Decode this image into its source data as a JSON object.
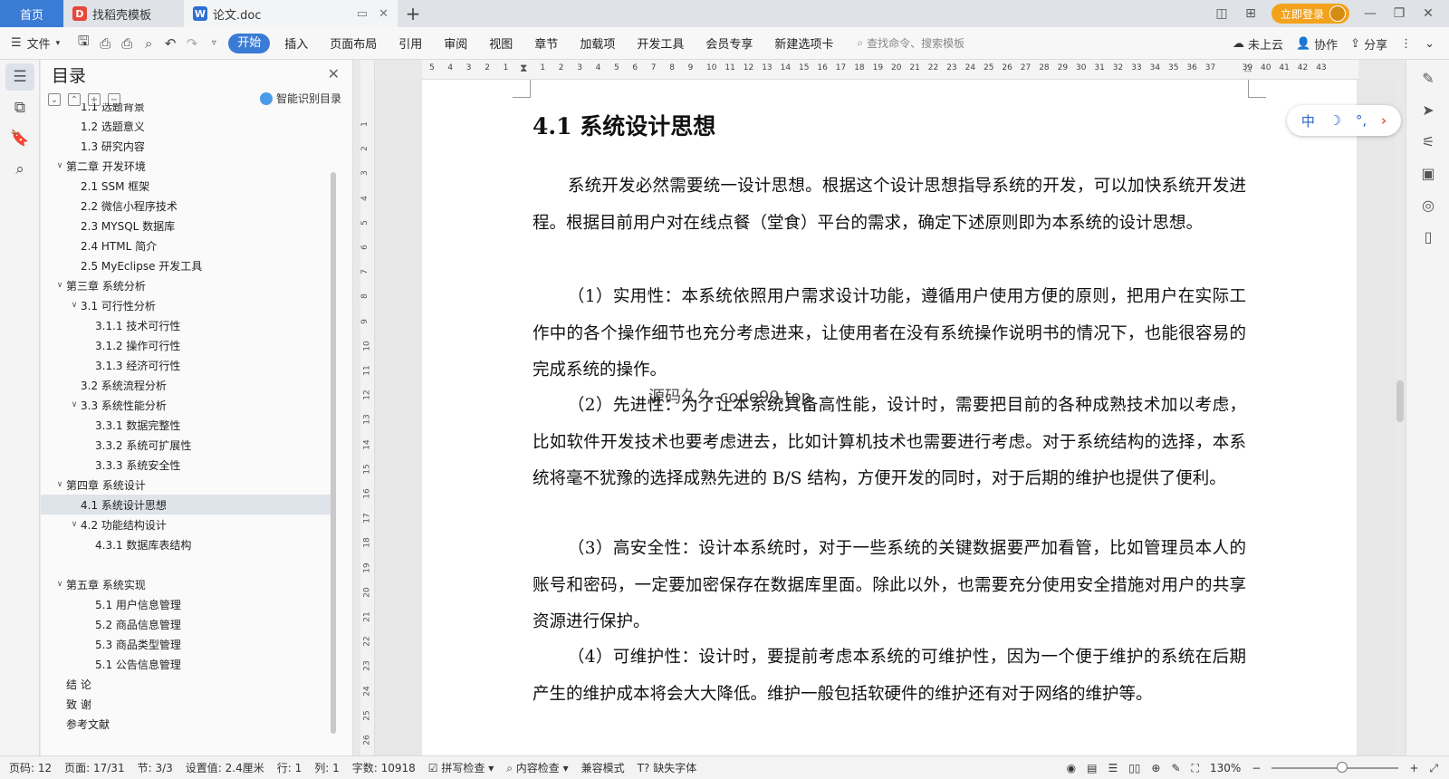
{
  "titlebar": {
    "tabs": [
      {
        "label": "首页"
      },
      {
        "label": "找稻壳模板"
      },
      {
        "label": "论文.doc"
      }
    ],
    "login_label": "立即登录"
  },
  "ribbon": {
    "file_label": "文件",
    "tabs": [
      "开始",
      "插入",
      "页面布局",
      "引用",
      "审阅",
      "视图",
      "章节",
      "加载项",
      "开发工具",
      "会员专享",
      "新建选项卡"
    ],
    "search_placeholder": "查找命令、搜索模板",
    "cloud_label": "未上云",
    "collab_label": "协作",
    "share_label": "分享"
  },
  "toc": {
    "title": "目录",
    "smart_label": "智能识别目录",
    "items": [
      {
        "label": "1.1 选题背景",
        "level": 2,
        "arrow": ""
      },
      {
        "label": "1.2 选题意义",
        "level": 2,
        "arrow": ""
      },
      {
        "label": "1.3 研究内容",
        "level": 2,
        "arrow": ""
      },
      {
        "label": "第二章  开发环境",
        "level": 1,
        "arrow": "v"
      },
      {
        "label": "2.1 SSM 框架",
        "level": 2,
        "arrow": ""
      },
      {
        "label": "2.2 微信小程序技术",
        "level": 2,
        "arrow": ""
      },
      {
        "label": "2.3 MYSQL 数据库",
        "level": 2,
        "arrow": ""
      },
      {
        "label": "2.4 HTML 简介",
        "level": 2,
        "arrow": ""
      },
      {
        "label": "2.5 MyEclipse 开发工具",
        "level": 2,
        "arrow": ""
      },
      {
        "label": "第三章  系统分析",
        "level": 1,
        "arrow": "v"
      },
      {
        "label": "3.1 可行性分析",
        "level": 2,
        "arrow": "v"
      },
      {
        "label": "3.1.1 技术可行性",
        "level": 3,
        "arrow": ""
      },
      {
        "label": "3.1.2 操作可行性",
        "level": 3,
        "arrow": ""
      },
      {
        "label": "3.1.3 经济可行性",
        "level": 3,
        "arrow": ""
      },
      {
        "label": "3.2 系统流程分析",
        "level": 2,
        "arrow": ""
      },
      {
        "label": "3.3 系统性能分析",
        "level": 2,
        "arrow": "v"
      },
      {
        "label": "3.3.1 数据完整性",
        "level": 3,
        "arrow": ""
      },
      {
        "label": "3.3.2 系统可扩展性",
        "level": 3,
        "arrow": ""
      },
      {
        "label": "3.3.3 系统安全性",
        "level": 3,
        "arrow": ""
      },
      {
        "label": "第四章  系统设计",
        "level": 1,
        "arrow": "v"
      },
      {
        "label": "4.1  系统设计思想",
        "level": 2,
        "arrow": "",
        "selected": true
      },
      {
        "label": "4.2 功能结构设计",
        "level": 2,
        "arrow": "v"
      },
      {
        "label": "4.3.1  数据库表结构",
        "level": 3,
        "arrow": ""
      },
      {
        "label": "",
        "level": 0,
        "arrow": "",
        "gap": true
      },
      {
        "label": "第五章  系统实现",
        "level": 1,
        "arrow": "v"
      },
      {
        "label": "5.1 用户信息管理",
        "level": 3,
        "arrow": ""
      },
      {
        "label": "5.2  商品信息管理",
        "level": 3,
        "arrow": ""
      },
      {
        "label": "5.3 商品类型管理",
        "level": 3,
        "arrow": ""
      },
      {
        "label": "5.1 公告信息管理",
        "level": 3,
        "arrow": ""
      },
      {
        "label": "结   论",
        "level": 1,
        "arrow": ""
      },
      {
        "label": "致   谢",
        "level": 1,
        "arrow": ""
      },
      {
        "label": "参考文献",
        "level": 1,
        "arrow": ""
      }
    ]
  },
  "ruler": {
    "h_labels": [
      "5",
      "4",
      "3",
      "2",
      "1",
      "",
      "1",
      "2",
      "3",
      "4",
      "5",
      "6",
      "7",
      "8",
      "9",
      "10",
      "11",
      "12",
      "13",
      "14",
      "15",
      "16",
      "17",
      "18",
      "19",
      "20",
      "21",
      "22",
      "23",
      "24",
      "25",
      "26",
      "27",
      "28",
      "29",
      "30",
      "31",
      "32",
      "33",
      "34",
      "35",
      "36",
      "37",
      "",
      "39",
      "40",
      "41",
      "42",
      "43"
    ],
    "v_labels": [
      "1",
      "2",
      "3",
      "4",
      "5",
      "6",
      "7",
      "8",
      "9",
      "10",
      "11",
      "12",
      "13",
      "14",
      "15",
      "16",
      "17",
      "18",
      "19",
      "20",
      "21",
      "22",
      "23",
      "24",
      "25",
      "26"
    ]
  },
  "document": {
    "heading": "4.1  系统设计思想",
    "paragraphs": [
      "系统开发必然需要统一设计思想。根据这个设计思想指导系统的开发，可以加快系统开发进程。根据目前用户对在线点餐（堂食）平台的需求，确定下述原则即为本系统的设计思想。",
      "（1）实用性：本系统依照用户需求设计功能，遵循用户使用方便的原则，把用户在实际工作中的各个操作细节也充分考虑进来，让使用者在没有系统操作说明书的情况下，也能很容易的完成系统的操作。",
      "（2）先进性：为了让本系统具备高性能，设计时，需要把目前的各种成熟技术加以考虑，比如软件开发技术也要考虑进去，比如计算机技术也需要进行考虑。对于系统结构的选择，本系统将毫不犹豫的选择成熟先进的 B/S 结构，方便开发的同时，对于后期的维护也提供了便利。",
      "（3）高安全性：设计本系统时，对于一些系统的关键数据要严加看管，比如管理员本人的账号和密码，一定要加密保存在数据库里面。除此以外，也需要充分使用安全措施对用户的共享资源进行保护。",
      "（4）可维护性：设计时，要提前考虑本系统的可维护性，因为一个便于维护的系统在后期产生的维护成本将会大大降低。维护一般包括软硬件的维护还有对于网络的维护等。"
    ],
    "watermark": "源码久久-code99.top"
  },
  "ime": {
    "label": "中"
  },
  "status": {
    "page_code": "页码: 12",
    "page": "页面: 17/31",
    "section": "节: 3/3",
    "setting": "设置值: 2.4厘米",
    "row": "行: 1",
    "col": "列: 1",
    "words": "字数: 10918",
    "spell": "拼写检查",
    "content_check": "内容检查",
    "compat": "兼容模式",
    "missing_font": "缺失字体",
    "zoom": "130%"
  }
}
